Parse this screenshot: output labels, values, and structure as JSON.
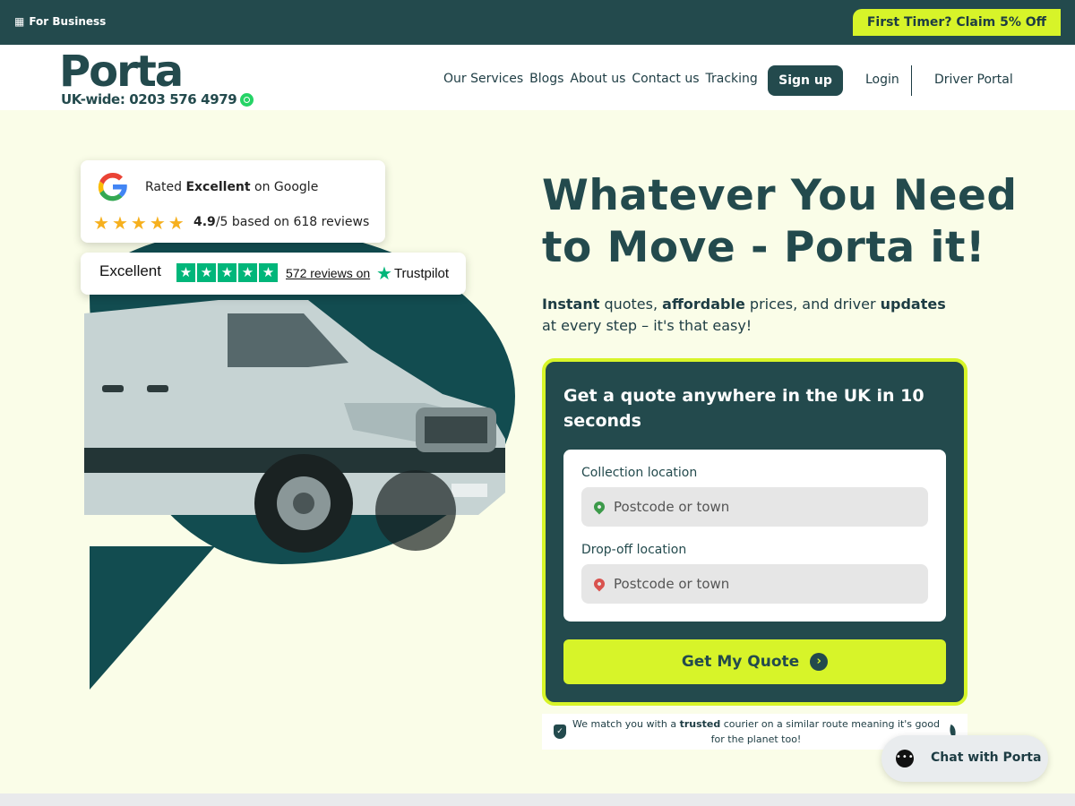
{
  "topbar": {
    "business_label": "For Business",
    "promo_label": "First Timer? Claim 5% Off"
  },
  "header": {
    "logo": "Porta",
    "phone": "UK-wide: 0203 576 4979",
    "nav": [
      "Our Services",
      "Blogs",
      "About us",
      "Contact us",
      "Tracking"
    ],
    "signup_label": "Sign up",
    "login_label": "Login",
    "driver_label": "Driver Portal"
  },
  "google_card": {
    "rated_prefix": "Rated ",
    "rated_word": "Excellent",
    "rated_suffix": " on Google",
    "stars": 5,
    "score_bold": "4.9",
    "score_rest": "/5 based on 618 reviews"
  },
  "trustpilot_card": {
    "rating_word": "Excellent",
    "stars": 5,
    "reviews_label": "572 reviews on",
    "brand": "Trustpilot"
  },
  "hero": {
    "headline_line1": "Whatever You Need",
    "headline_line2_regular": "to Move - ",
    "headline_line2_bold": "Porta it!",
    "sub_1_bold": "Instant",
    "sub_2": " quotes, ",
    "sub_3_bold": "affordable",
    "sub_4": " prices, and driver ",
    "sub_5_bold": "updates",
    "sub_6": " at every step – it's that easy!"
  },
  "quote": {
    "title": "Get a quote anywhere in the UK in 10 seconds",
    "collection_label": "Collection location",
    "collection_placeholder": "Postcode or town",
    "dropoff_label": "Drop-off location",
    "dropoff_placeholder": "Postcode or town",
    "cta_label": "Get My Quote"
  },
  "eco": {
    "text_1": "We match you with a ",
    "text_bold": "trusted",
    "text_2": " courier on a similar route meaning it's good for the planet too!"
  },
  "chat": {
    "label": "Chat with Porta"
  },
  "colors": {
    "brand_dark": "#234a4d",
    "accent_lime": "#d7f429",
    "hero_bg": "#fafde8",
    "trustpilot_green": "#00b67a",
    "google_star": "#f6b01e"
  }
}
